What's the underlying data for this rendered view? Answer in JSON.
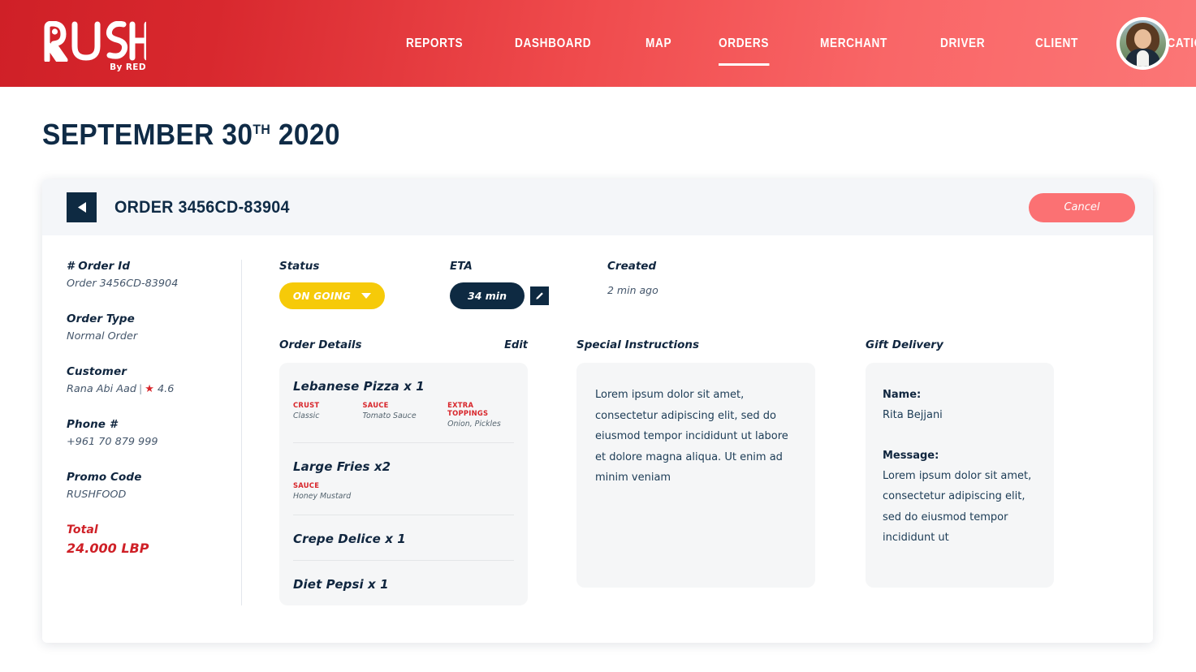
{
  "header": {
    "logo": {
      "text": "RUSH",
      "sub": "By RED",
      "icon": "rush-pin-logo"
    },
    "nav": [
      {
        "label": "REPORTS",
        "active": false
      },
      {
        "label": "DASHBOARD",
        "active": false
      },
      {
        "label": "MAP",
        "active": false
      },
      {
        "label": "ORDERS",
        "active": true
      },
      {
        "label": "MERCHANT",
        "active": false
      },
      {
        "label": "DRIVER",
        "active": false
      },
      {
        "label": "CLIENT",
        "active": false
      },
      {
        "label": "NOTIFICATION",
        "active": false
      }
    ],
    "avatar": "user-avatar"
  },
  "page": {
    "title_month_day": "SEPTEMBER 30",
    "title_ordinal": "TH",
    "title_year": "2020"
  },
  "order_panel": {
    "back_icon": "back-arrow-icon",
    "title": "ORDER 3456CD-83904",
    "cancel_label": "Cancel"
  },
  "info": [
    {
      "label": "# Order Id",
      "value": "Order 3456CD-83904"
    },
    {
      "label": "Order Type",
      "value": "Normal Order"
    },
    {
      "label": "Customer",
      "value": "Rana Abi Aad",
      "separator": "|",
      "rating": "4.6",
      "star_icon": "star-icon"
    },
    {
      "label": "Phone #",
      "value": "+961 70 879 999"
    },
    {
      "label": "Promo Code",
      "value": "RUSHFOOD"
    },
    {
      "label": "Total",
      "value": "24.000 LBP"
    }
  ],
  "status": {
    "label": "Status",
    "value": "ON GOING",
    "caret_icon": "chevron-down-icon"
  },
  "eta": {
    "label": "ETA",
    "value": "34 min",
    "edit_icon": "pencil-icon"
  },
  "created": {
    "label": "Created",
    "value": "2 min ago"
  },
  "order_details": {
    "title": "Order Details",
    "edit_label": "Edit",
    "items": [
      {
        "name": "Lebanese Pizza x 1",
        "options": [
          {
            "label": "CRUST",
            "value": "Classic"
          },
          {
            "label": "SAUCE",
            "value": "Tomato Sauce"
          },
          {
            "label": "EXTRA TOPPINGS",
            "value": "Onion, Pickles"
          }
        ]
      },
      {
        "name": "Large Fries x2",
        "options": [
          {
            "label": "SAUCE",
            "value": "Honey Mustard"
          }
        ]
      },
      {
        "name": "Crepe Delice x 1",
        "options": []
      },
      {
        "name": "Diet Pepsi x 1",
        "options": []
      }
    ]
  },
  "special_instructions": {
    "title": "Special Instructions",
    "text": "Lorem ipsum dolor sit amet, consectetur adipiscing elit, sed do eiusmod tempor incididunt ut labore et dolore magna aliqua. Ut enim ad minim veniam"
  },
  "gift_delivery": {
    "title": "Gift Delivery",
    "name_label": "Name:",
    "name_value": "Rita Bejjani",
    "message_label": "Message:",
    "message_value": "Lorem ipsum dolor sit amet, consectetur adipiscing elit, sed do eiusmod tempor incididunt ut"
  },
  "colors": {
    "brand_red_dark": "#cf2027",
    "brand_red_light": "#fb7676",
    "navy": "#0e2a42",
    "status_yellow": "#f6ca09",
    "cancel_pink": "#fb7173",
    "card_gray": "#f5f6f7"
  }
}
